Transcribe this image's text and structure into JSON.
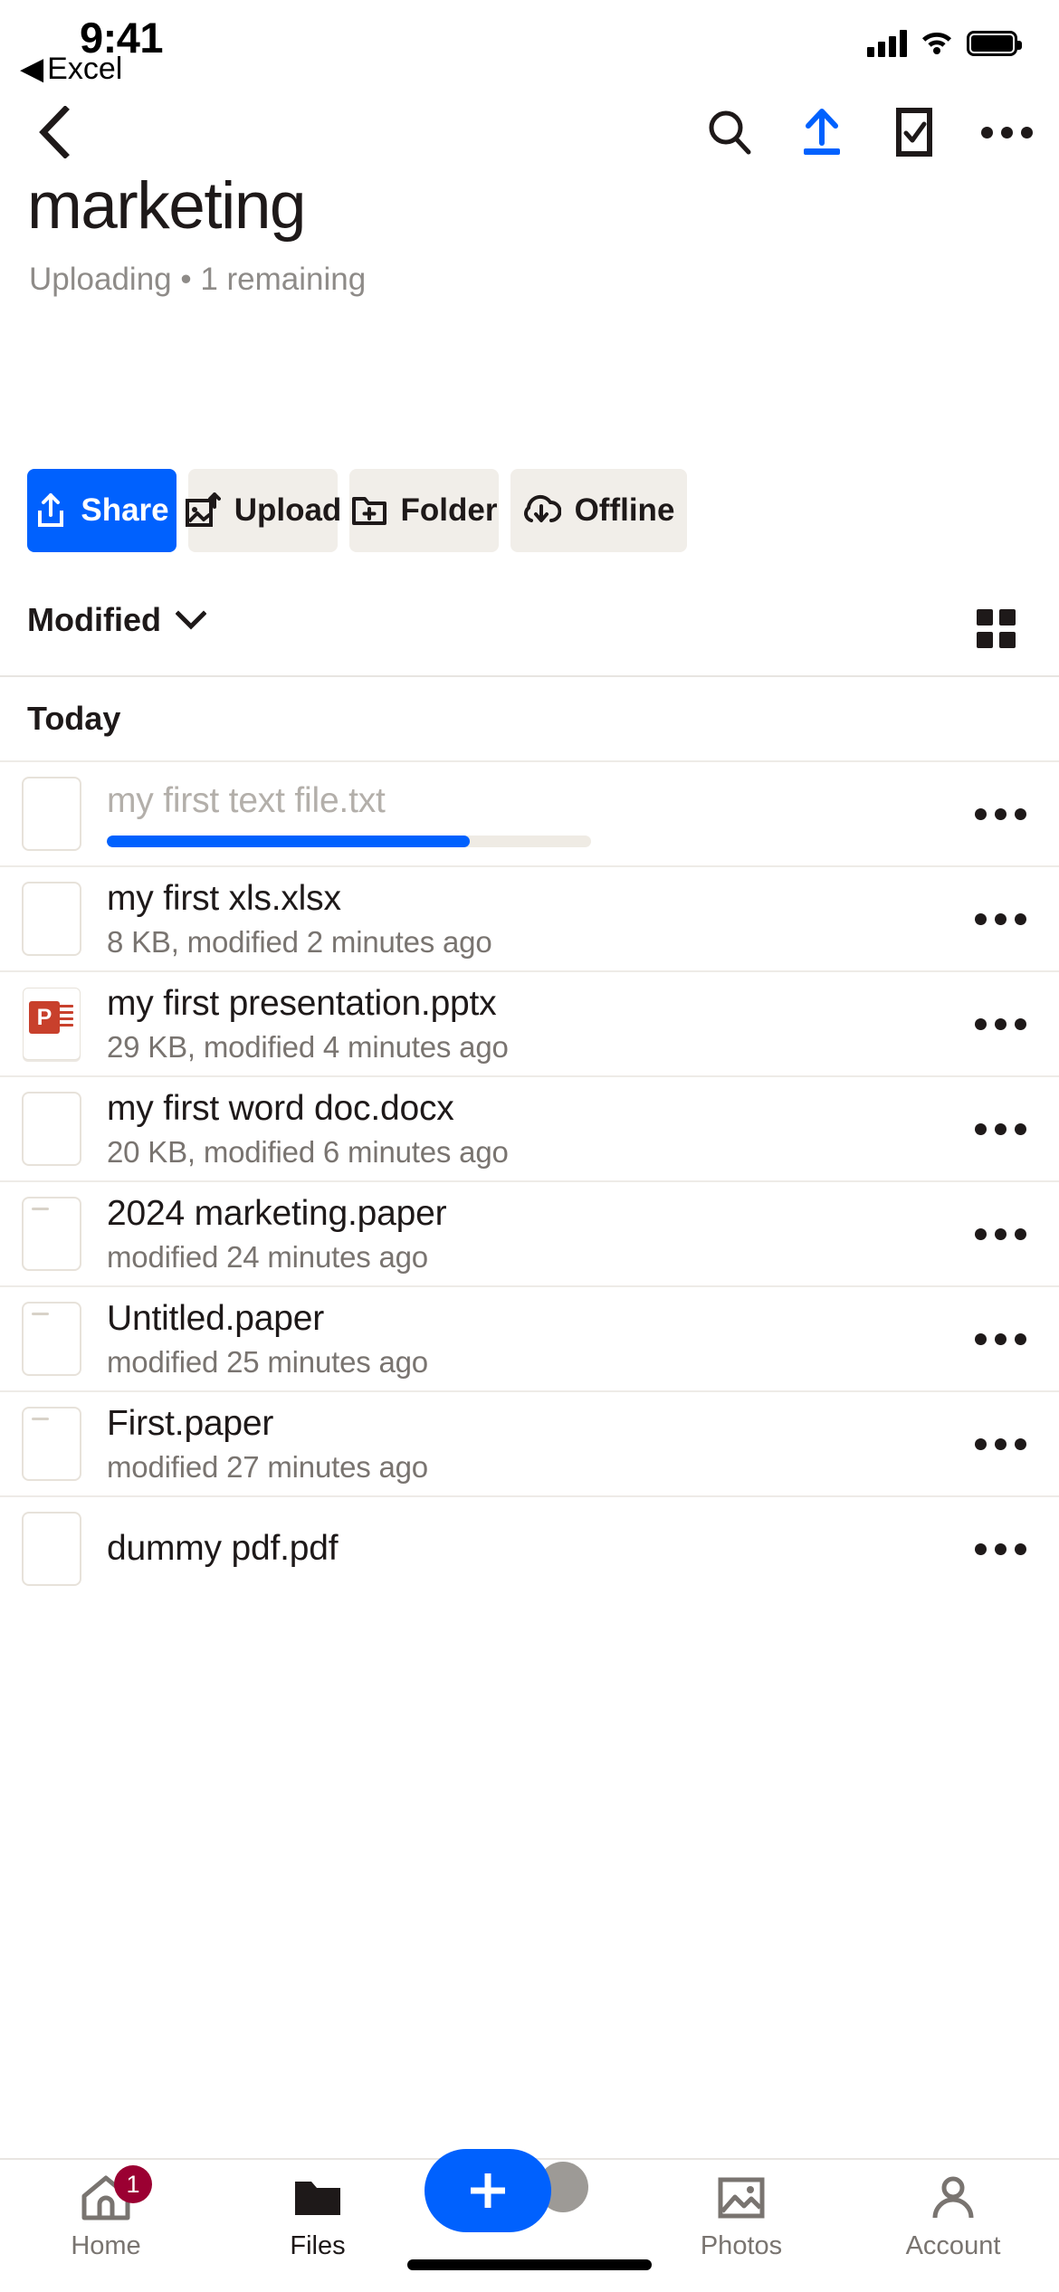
{
  "status_bar": {
    "time": "9:41",
    "back_app_label": "Excel",
    "back_app_arrow": "◀",
    "signal_icon": "cellular-signal-icon",
    "wifi_icon": "wifi-icon",
    "battery_icon": "battery-icon"
  },
  "nav_bar": {
    "back_icon": "chevron-left-icon",
    "search_icon": "search-icon",
    "upload_icon": "upload-icon",
    "select_icon": "checkbox-select-icon",
    "overflow_icon": "more-horizontal-icon",
    "upload_accent": "#0061FE"
  },
  "header": {
    "title": "marketing",
    "subtitle": "Uploading • 1 remaining"
  },
  "actions": [
    {
      "label": "Share",
      "icon": "share-icon",
      "primary": true
    },
    {
      "label": "Upload",
      "icon": "image-upload-icon",
      "primary": false
    },
    {
      "label": "Folder",
      "icon": "folder-plus-icon",
      "primary": false
    },
    {
      "label": "Offline",
      "icon": "cloud-download-icon",
      "primary": false
    }
  ],
  "sort_row": {
    "sort_label": "Modified",
    "chevron_icon": "chevron-down-icon",
    "view_toggle_icon": "grid-view-icon"
  },
  "list": {
    "section_label": "Today",
    "items": [
      {
        "name": "my first text file.txt",
        "meta": "",
        "icon": "blank-doc-icon",
        "uploading": true,
        "progress": 75,
        "more_icon": "more-horizontal-icon"
      },
      {
        "name": "my first xls.xlsx",
        "meta": "8 KB, modified 2 minutes ago",
        "icon": "blank-doc-icon",
        "uploading": false,
        "more_icon": "more-horizontal-icon"
      },
      {
        "name": "my first presentation.pptx",
        "meta": "29 KB, modified 4 minutes ago",
        "icon": "powerpoint-icon",
        "uploading": false,
        "more_icon": "more-horizontal-icon"
      },
      {
        "name": "my first word doc.docx",
        "meta": "20 KB, modified 6 minutes ago",
        "icon": "blank-doc-icon",
        "uploading": false,
        "more_icon": "more-horizontal-icon"
      },
      {
        "name": "2024 marketing.paper",
        "meta": "modified 24 minutes ago",
        "icon": "paper-doc-icon",
        "uploading": false,
        "more_icon": "more-horizontal-icon"
      },
      {
        "name": "Untitled.paper",
        "meta": "modified 25 minutes ago",
        "icon": "paper-doc-icon",
        "uploading": false,
        "more_icon": "more-horizontal-icon"
      },
      {
        "name": "First.paper",
        "meta": "modified 27 minutes ago",
        "icon": "paper-doc-icon",
        "uploading": false,
        "more_icon": "more-horizontal-icon"
      },
      {
        "name": "dummy pdf.pdf",
        "meta": "",
        "icon": "blank-doc-icon",
        "uploading": false,
        "more_icon": "more-horizontal-icon"
      }
    ]
  },
  "tab_bar": {
    "tabs": [
      {
        "label": "Home",
        "icon": "home-icon",
        "active": false,
        "badge": "1"
      },
      {
        "label": "Files",
        "icon": "folder-icon",
        "active": true,
        "badge": ""
      },
      {
        "label": "Photos",
        "icon": "photos-icon",
        "active": false,
        "badge": ""
      },
      {
        "label": "Account",
        "icon": "account-icon",
        "active": false,
        "badge": ""
      }
    ],
    "create_button": {
      "icon": "plus-icon",
      "color": "#0061FE"
    },
    "badge_color": "#9B0032"
  }
}
